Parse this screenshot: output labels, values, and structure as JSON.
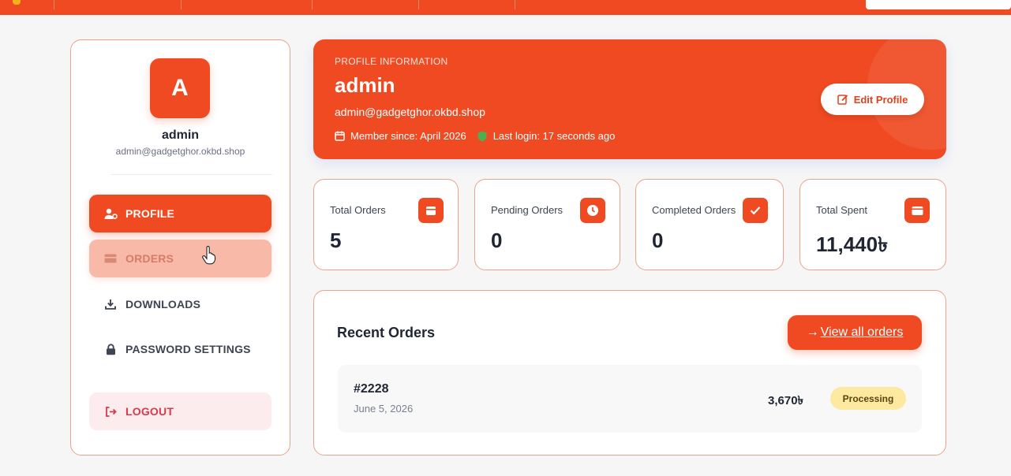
{
  "colors": {
    "accent": "#ef4a22",
    "page_bg": "#f6f6f7",
    "badge_processing": "#fde9a0",
    "logout_bg": "#fdecee"
  },
  "sidebar": {
    "avatar_letter": "A",
    "name": "admin",
    "email": "admin@gadgetghor.okbd.shop",
    "items": [
      {
        "label": "PROFILE",
        "icon": "user-gear-icon",
        "state": "active"
      },
      {
        "label": "ORDERS",
        "icon": "box-icon",
        "state": "hover"
      },
      {
        "label": "DOWNLOADS",
        "icon": "download-icon",
        "state": "default"
      },
      {
        "label": "PASSWORD SETTINGS",
        "icon": "lock-icon",
        "state": "default"
      }
    ],
    "logout": {
      "label": "LOGOUT",
      "icon": "logout-icon"
    }
  },
  "profile": {
    "kicker": "PROFILE INFORMATION",
    "name": "admin",
    "email": "admin@gadgetghor.okbd.shop",
    "member_since": "Member since: April 2026",
    "last_login": "Last login: 17 seconds ago",
    "edit_label": "Edit Profile"
  },
  "stats": [
    {
      "label": "Total Orders",
      "value": "5",
      "icon": "box-icon"
    },
    {
      "label": "Pending Orders",
      "value": "0",
      "icon": "clock-icon"
    },
    {
      "label": "Completed Orders",
      "value": "0",
      "icon": "check-icon"
    },
    {
      "label": "Total Spent",
      "value": "11,440৳",
      "icon": "wallet-icon"
    }
  ],
  "recent_orders": {
    "title": "Recent Orders",
    "view_all_label": "View all orders",
    "orders": [
      {
        "id": "#2228",
        "date": "June 5, 2026",
        "amount": "3,670৳",
        "status": "Processing"
      }
    ]
  }
}
